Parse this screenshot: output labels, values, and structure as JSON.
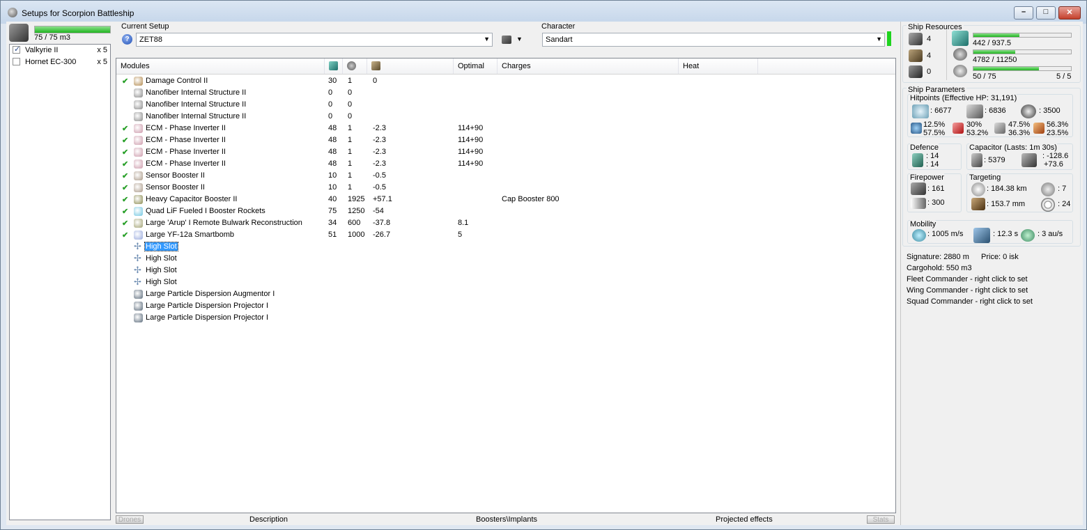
{
  "window": {
    "title": "Setups for Scorpion Battleship"
  },
  "drones": {
    "fill_fraction": 1.0,
    "volume": "75 / 75 m3",
    "items": [
      {
        "name": "Valkyrie II",
        "count": "x 5",
        "checked": true
      },
      {
        "name": "Hornet EC-300",
        "count": "x 5",
        "checked": false
      }
    ]
  },
  "setup": {
    "label": "Current Setup",
    "value": "ZET88"
  },
  "character": {
    "label": "Character",
    "value": "Sandart"
  },
  "grid": {
    "columns": [
      "Modules",
      "",
      "",
      "",
      "Optimal",
      "Charges",
      "Heat"
    ],
    "rows": [
      {
        "check": "✔",
        "name": "Damage Control II",
        "cpu": "30",
        "pg": "1",
        "cap": "0",
        "optimal": "",
        "charges": ""
      },
      {
        "check": "",
        "name": "Nanofiber Internal Structure II",
        "cpu": "0",
        "pg": "0",
        "cap": "",
        "optimal": "",
        "charges": ""
      },
      {
        "check": "",
        "name": "Nanofiber Internal Structure II",
        "cpu": "0",
        "pg": "0",
        "cap": "",
        "optimal": "",
        "charges": ""
      },
      {
        "check": "",
        "name": "Nanofiber Internal Structure II",
        "cpu": "0",
        "pg": "0",
        "cap": "",
        "optimal": "",
        "charges": ""
      },
      {
        "check": "✔",
        "name": "ECM - Phase Inverter II",
        "cpu": "48",
        "pg": "1",
        "cap": "-2.3",
        "optimal": "114+90",
        "charges": ""
      },
      {
        "check": "✔",
        "name": "ECM - Phase Inverter II",
        "cpu": "48",
        "pg": "1",
        "cap": "-2.3",
        "optimal": "114+90",
        "charges": ""
      },
      {
        "check": "✔",
        "name": "ECM - Phase Inverter II",
        "cpu": "48",
        "pg": "1",
        "cap": "-2.3",
        "optimal": "114+90",
        "charges": ""
      },
      {
        "check": "✔",
        "name": "ECM - Phase Inverter II",
        "cpu": "48",
        "pg": "1",
        "cap": "-2.3",
        "optimal": "114+90",
        "charges": ""
      },
      {
        "check": "✔",
        "name": "Sensor Booster II",
        "cpu": "10",
        "pg": "1",
        "cap": "-0.5",
        "optimal": "",
        "charges": ""
      },
      {
        "check": "✔",
        "name": "Sensor Booster II",
        "cpu": "10",
        "pg": "1",
        "cap": "-0.5",
        "optimal": "",
        "charges": ""
      },
      {
        "check": "✔",
        "name": "Heavy Capacitor Booster II",
        "cpu": "40",
        "pg": "1925",
        "cap": "+57.1",
        "optimal": "",
        "charges": "Cap Booster 800"
      },
      {
        "check": "✔",
        "name": "Quad LiF Fueled I Booster Rockets",
        "cpu": "75",
        "pg": "1250",
        "cap": "-54",
        "optimal": "",
        "charges": ""
      },
      {
        "check": "✔",
        "name": "Large 'Arup' I Remote Bulwark Reconstruction",
        "cpu": "34",
        "pg": "600",
        "cap": "-37.8",
        "optimal": "8.1",
        "charges": ""
      },
      {
        "check": "✔",
        "name": "Large YF-12a Smartbomb",
        "cpu": "51",
        "pg": "1000",
        "cap": "-26.7",
        "optimal": "5",
        "charges": ""
      },
      {
        "check": "",
        "name": "High Slot",
        "cpu": "",
        "pg": "",
        "cap": "",
        "optimal": "",
        "charges": "",
        "selected": true
      },
      {
        "check": "",
        "name": "High Slot",
        "cpu": "",
        "pg": "",
        "cap": "",
        "optimal": "",
        "charges": ""
      },
      {
        "check": "",
        "name": "High Slot",
        "cpu": "",
        "pg": "",
        "cap": "",
        "optimal": "",
        "charges": ""
      },
      {
        "check": "",
        "name": "High Slot",
        "cpu": "",
        "pg": "",
        "cap": "",
        "optimal": "",
        "charges": ""
      },
      {
        "check": "",
        "name": "Large Particle Dispersion Augmentor I",
        "cpu": "",
        "pg": "",
        "cap": "",
        "optimal": "",
        "charges": ""
      },
      {
        "check": "",
        "name": "Large Particle Dispersion Projector I",
        "cpu": "",
        "pg": "",
        "cap": "",
        "optimal": "",
        "charges": ""
      },
      {
        "check": "",
        "name": "Large Particle Dispersion Projector I",
        "cpu": "",
        "pg": "",
        "cap": "",
        "optimal": "",
        "charges": ""
      }
    ]
  },
  "bottom_tabs": {
    "drones": "Drones",
    "description": "Description",
    "boosters": "Boosters\\Implants",
    "projected": "Projected effects",
    "stats": "Stats"
  },
  "resources": {
    "title": "Ship Resources",
    "turrets": "4",
    "launchers": "4",
    "calibration": "0",
    "cpu": "442 / 937.5",
    "cpu_fraction": 0.47,
    "powergrid": "4782 / 11250",
    "pg_fraction": 0.43,
    "drones": "50 / 75",
    "drones_fraction": 0.67,
    "drone_slots": "5 / 5"
  },
  "params": {
    "title": "Ship Parameters",
    "hitpoints_title": "Hitpoints (Effective HP: 31,191)",
    "shield": ": 6677",
    "armor": ": 6836",
    "structure": ": 3500",
    "res_em_top": "12.5%",
    "res_em_bottom": "57.5%",
    "res_th_top": "30%",
    "res_th_bottom": "53.2%",
    "res_kin_top": "47.5%",
    "res_kin_bottom": "36.3%",
    "res_exp_top": "56.3%",
    "res_exp_bottom": "23.5%",
    "defence_title": "Defence",
    "defence_1": ": 14",
    "defence_2": ": 14",
    "capacitor_title": "Capacitor (Lasts: 1m 30s)",
    "cap_amount": ": 5379",
    "cap_delta_1": ": -128.6",
    "cap_delta_2": "+73.6",
    "firepower_title": "Firepower",
    "dps": ": 161",
    "volley": ": 300",
    "targeting_title": "Targeting",
    "range": ": 184.38 km",
    "max_targets": ": 7",
    "scan_res": ": 153.7 mm",
    "sensor": ": 24",
    "mobility_title": "Mobility",
    "speed": ": 1005 m/s",
    "align": ": 12.3 s",
    "warp": ": 3 au/s",
    "signature": "Signature: 2880 m",
    "price": "Price: 0 isk",
    "cargohold": "Cargohold: 550 m3",
    "fleet": "Fleet Commander - right click to set",
    "wing": "Wing Commander - right click to set",
    "squad": "Squad Commander - right click to set"
  },
  "colors": {
    "accent_green": "#1fd31f",
    "selection": "#3399ff"
  }
}
